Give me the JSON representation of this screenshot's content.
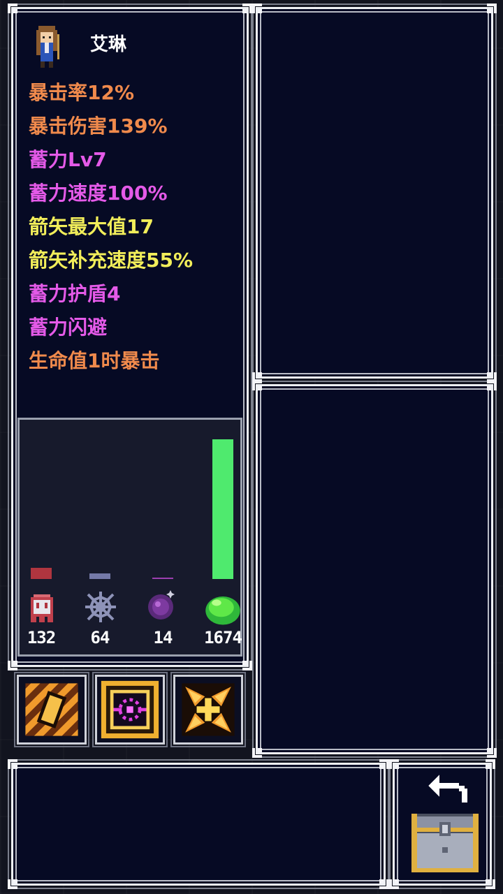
{
  "hero": {
    "name": "艾琳",
    "portrait_icon": "archer-girl-portrait-icon"
  },
  "stats": [
    {
      "text": "暴击率12%",
      "color": "#f08a4c"
    },
    {
      "text": "暴击伤害139%",
      "color": "#f08a4c"
    },
    {
      "text": "蓄力Lv7",
      "color": "#e45ae8"
    },
    {
      "text": "蓄力速度100%",
      "color": "#e45ae8"
    },
    {
      "text": "箭矢最大值17",
      "color": "#f2ee5a"
    },
    {
      "text": "箭矢补充速度55%",
      "color": "#f2ee5a"
    },
    {
      "text": "蓄力护盾4",
      "color": "#e45ae8"
    },
    {
      "text": "蓄力闪避",
      "color": "#e45ae8"
    },
    {
      "text": "生命值1时暴击",
      "color": "#f08a4c"
    }
  ],
  "resources": [
    {
      "icon": "ghost-icon",
      "value": "132",
      "bar_level": 0.08,
      "bar_color": "#b0353f"
    },
    {
      "icon": "cobweb-icon",
      "value": "64",
      "bar_level": 0.04,
      "bar_color": "#7479a8"
    },
    {
      "icon": "purple-orb-icon",
      "value": "14",
      "bar_level": 0.01,
      "bar_color": "#9c3fb0"
    },
    {
      "icon": "green-slime-icon",
      "value": "1674",
      "bar_level": 1.0,
      "bar_color": "#4fea6e"
    }
  ],
  "skills": [
    {
      "icon": "striped-scroll-skill-icon"
    },
    {
      "icon": "magenta-target-skill-icon"
    },
    {
      "icon": "cross-burst-skill-icon"
    }
  ],
  "chest": {
    "icon": "treasure-chest-return-icon"
  }
}
